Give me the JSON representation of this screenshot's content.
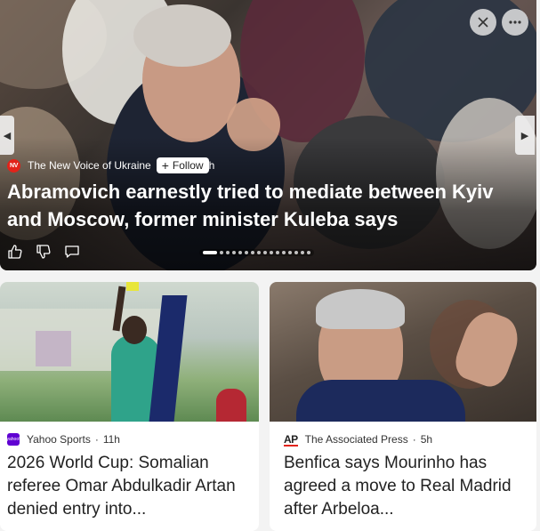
{
  "hero": {
    "source_name": "The New Voice of Ukraine",
    "source_logo": "NV",
    "follow_label": "Follow",
    "time_fragment": "h",
    "title": "Abramovich earnestly tried to mediate between Kyiv and Moscow, former minister Kuleba says",
    "carousel_total": 16,
    "carousel_active_index": 0
  },
  "cards": [
    {
      "source_name": "Yahoo Sports",
      "source_logo": "yahoo!",
      "time": "11h",
      "title": "2026 World Cup: Somalian referee Omar Abdulkadir Artan denied entry into..."
    },
    {
      "source_name": "The Associated Press",
      "source_logo": "AP",
      "time": "5h",
      "title": "Benfica says Mourinho has agreed a move to Real Madrid after Arbeloa..."
    }
  ],
  "meta_separator": "·",
  "icons": {
    "close": "close-icon",
    "more": "more-icon",
    "prev": "chevron-left-icon",
    "next": "chevron-right-icon",
    "like": "thumbs-up-icon",
    "dislike": "thumbs-down-icon",
    "comment": "comment-icon"
  },
  "colors": {
    "nv_red": "#e2231a",
    "yahoo_purple": "#6001d2",
    "ap_red": "#e2231a"
  }
}
